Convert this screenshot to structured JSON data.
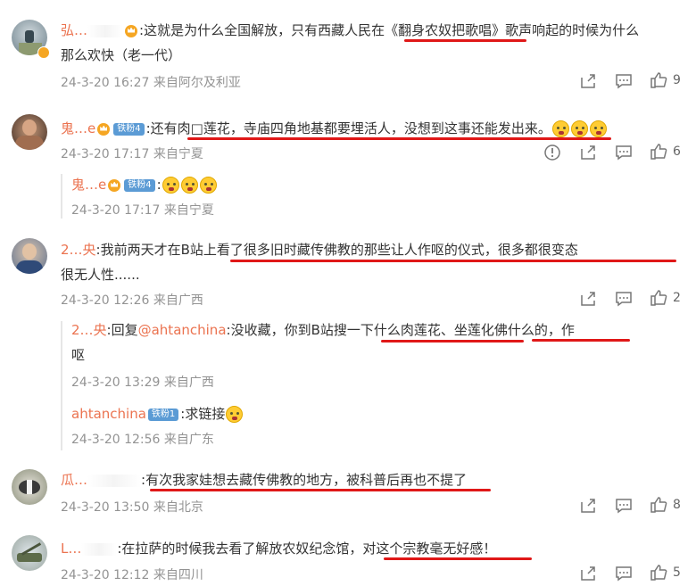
{
  "comments": [
    {
      "user": "弘…",
      "text_line1": ":这就是为什么全国解放，只有西藏人民在《翻身农奴把歌唱》歌声响起的时候为什么",
      "text_line2": "那么欢快（老一代）",
      "time": "24-3-20 16:27",
      "location": "来自阿尔及利亚",
      "likes": "9"
    },
    {
      "user": "鬼…e",
      "badge": "铁粉4",
      "text_line1": ":还有肉□莲花，寺庙四角地基都要埋活人，没想到这事还能发出来。",
      "time": "24-3-20 17:17",
      "location": "来自宁夏",
      "likes": "6",
      "reply": {
        "user": "鬼…e",
        "badge": "铁粉4",
        "text": ":",
        "time": "24-3-20 17:17",
        "location": "来自宁夏"
      }
    },
    {
      "user": "2…央",
      "text_line1": ":我前两天才在B站上看了很多旧时藏传佛教的那些让人作呕的仪式，很多都很变态",
      "text_line2": "很无人性......",
      "time": "24-3-20 12:26",
      "location": "来自广西",
      "likes": "2",
      "replies": [
        {
          "user": "2…央",
          "text_prefix": ":回复",
          "mention": "@ahtanchina",
          "text_line1": ":没收藏，你到B站搜一下什么肉莲花、坐莲化佛什么的，作",
          "text_line2": "呕",
          "time": "24-3-20 13:29",
          "location": "来自广西"
        },
        {
          "user": "ahtanchina",
          "badge": "铁粉1",
          "text": ":求链接",
          "time": "24-3-20 12:56",
          "location": "来自广东"
        }
      ]
    },
    {
      "user": "瓜…",
      "text_line1": ":有次我家娃想去藏传佛教的地方，被科普后再也不提了",
      "time": "24-3-20 13:50",
      "location": "来自北京",
      "likes": "8"
    },
    {
      "user": "L…",
      "text_line1": ":在拉萨的时候我去看了解放农奴纪念馆，对这个宗教毫无好感！",
      "time": "24-3-20 12:12",
      "location": "来自四川",
      "likes": "5"
    }
  ],
  "icons": [
    "share-icon",
    "comment-icon",
    "like-icon",
    "report-icon",
    "crown-icon",
    "emoji-icon"
  ],
  "colors": {
    "username": "#eb7350",
    "mention": "#eb7350",
    "meta": "#939393",
    "annotation": "#e01818",
    "fan_badge": "#5b9bd5"
  }
}
